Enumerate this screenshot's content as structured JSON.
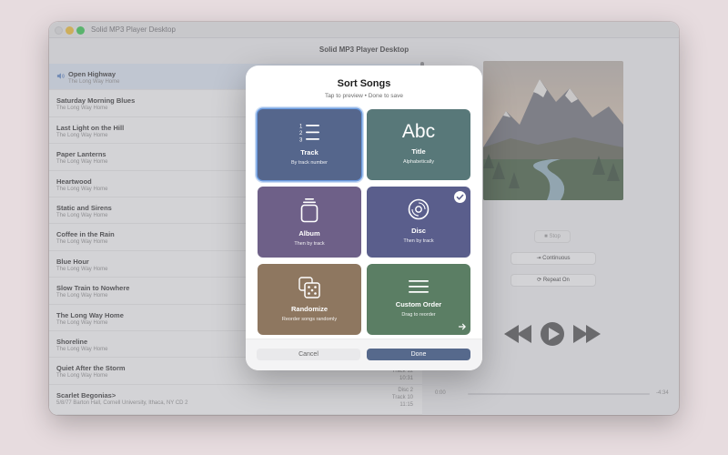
{
  "window": {
    "title": "Solid MP3 Player Desktop",
    "toolbar_title": "Solid MP3 Player Desktop"
  },
  "songs": [
    {
      "title": "Open Highway",
      "album": "The Long Way Home",
      "playing": true
    },
    {
      "title": "Saturday Morning Blues",
      "album": "The Long Way Home"
    },
    {
      "title": "Last Light on the Hill",
      "album": "The Long Way Home"
    },
    {
      "title": "Paper Lanterns",
      "album": "The Long Way Home"
    },
    {
      "title": "Heartwood",
      "album": "The Long Way Home"
    },
    {
      "title": "Static and Sirens",
      "album": "The Long Way Home"
    },
    {
      "title": "Coffee in the Rain",
      "album": "The Long Way Home"
    },
    {
      "title": "Blue Hour",
      "album": "The Long Way Home"
    },
    {
      "title": "Slow Train to Nowhere",
      "album": "The Long Way Home"
    },
    {
      "title": "The Long Way Home",
      "album": "The Long Way Home"
    },
    {
      "title": "Shoreline",
      "album": "The Long Way Home"
    },
    {
      "title": "Quiet After the Storm",
      "album": "The Long Way Home",
      "meta": [
        "Track 12",
        "10:31"
      ]
    },
    {
      "title": "Scarlet Begonias>",
      "album": "5/8/77 Barton Hall, Cornell University, Ithaca, NY CD 2",
      "meta": [
        "Disc 2",
        "Track 10",
        "11:15"
      ]
    }
  ],
  "player": {
    "stop_label": "Stop",
    "continuous_label": "Continuous",
    "repeat_label": "Repeat On",
    "time_elapsed": "0:00",
    "time_remaining": "-4:34",
    "progress": 0
  },
  "modal": {
    "title": "Sort Songs",
    "subtitle": "Tap to preview • Done to save",
    "cards": [
      {
        "label": "Track",
        "desc": "By track number",
        "color": "#55668c",
        "icon": "numbered-list-icon",
        "selected": true
      },
      {
        "label": "Title",
        "desc": "Alphabetically",
        "color": "#587879",
        "icon": "abc-text-icon",
        "icon_text": "Abc"
      },
      {
        "label": "Album",
        "desc": "Then by track",
        "color": "#6e6088",
        "icon": "album-stack-icon"
      },
      {
        "label": "Disc",
        "desc": "Then by track",
        "color": "#5a5e8c",
        "icon": "disc-icon",
        "checked": true
      },
      {
        "label": "Randomize",
        "desc": "Reorder songs randomly",
        "color": "#8e7760",
        "icon": "dice-icon"
      },
      {
        "label": "Custom Order",
        "desc": "Drag to reorder",
        "color": "#5b7e64",
        "icon": "lines-icon"
      }
    ],
    "cancel_label": "Cancel",
    "done_label": "Done"
  }
}
